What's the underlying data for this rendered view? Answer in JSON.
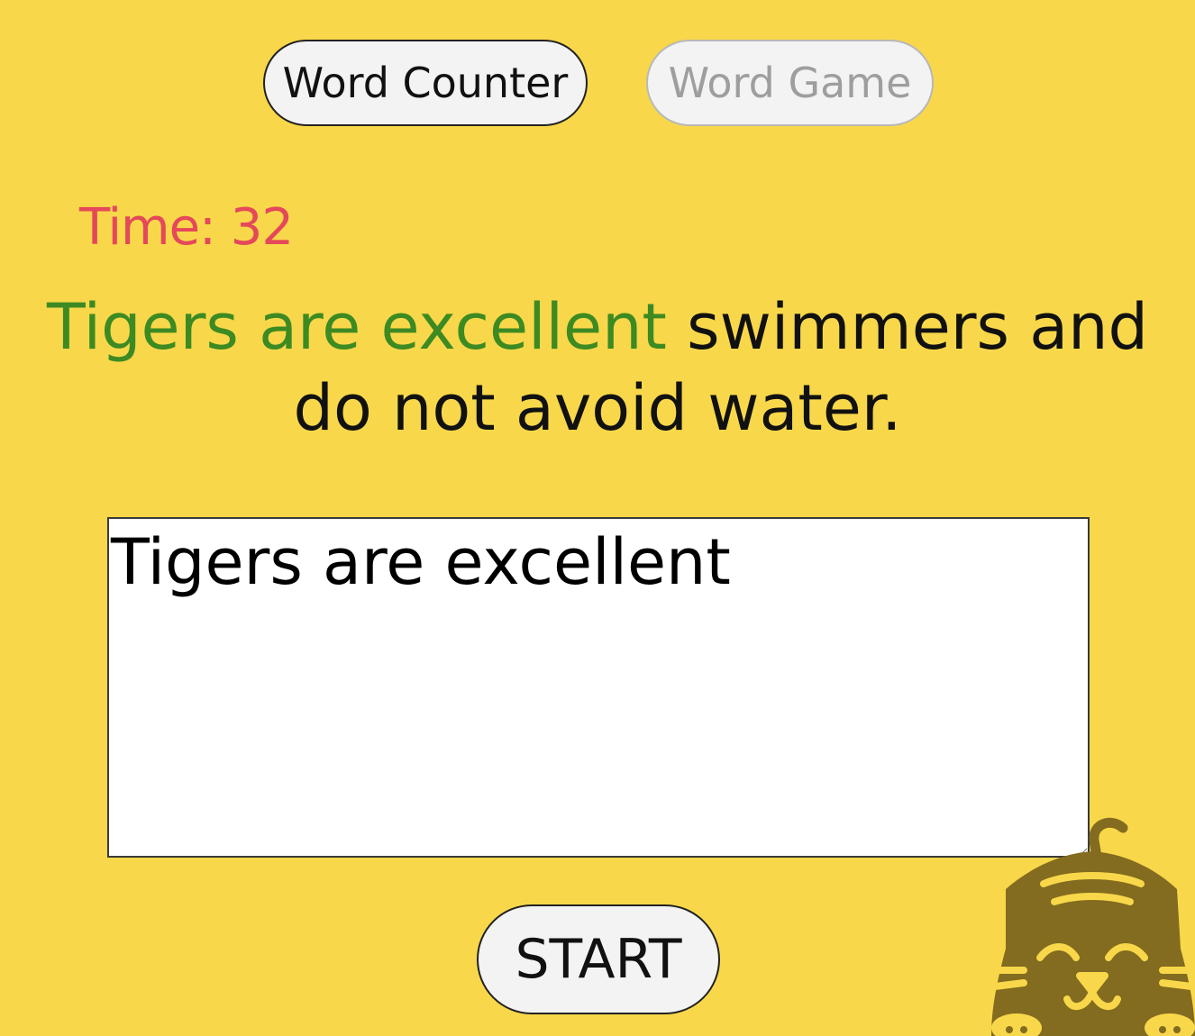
{
  "tabs": [
    {
      "label": "Word Counter",
      "active": true
    },
    {
      "label": "Word Game",
      "active": false
    }
  ],
  "timer": {
    "label": "Time:",
    "value": "32",
    "color": "#e4485a"
  },
  "prompt": {
    "typed": "Tigers are excellent",
    "remaining": "swimmers and do not avoid water.",
    "typed_color": "#3d8a22"
  },
  "input": {
    "value": "Tigers are excellent"
  },
  "start_button": {
    "label": "START"
  },
  "mascot": {
    "icon": "cat-icon",
    "color": "#836b1f"
  },
  "theme": {
    "background": "#f8d84a",
    "button_bg": "#f3f3f3"
  }
}
